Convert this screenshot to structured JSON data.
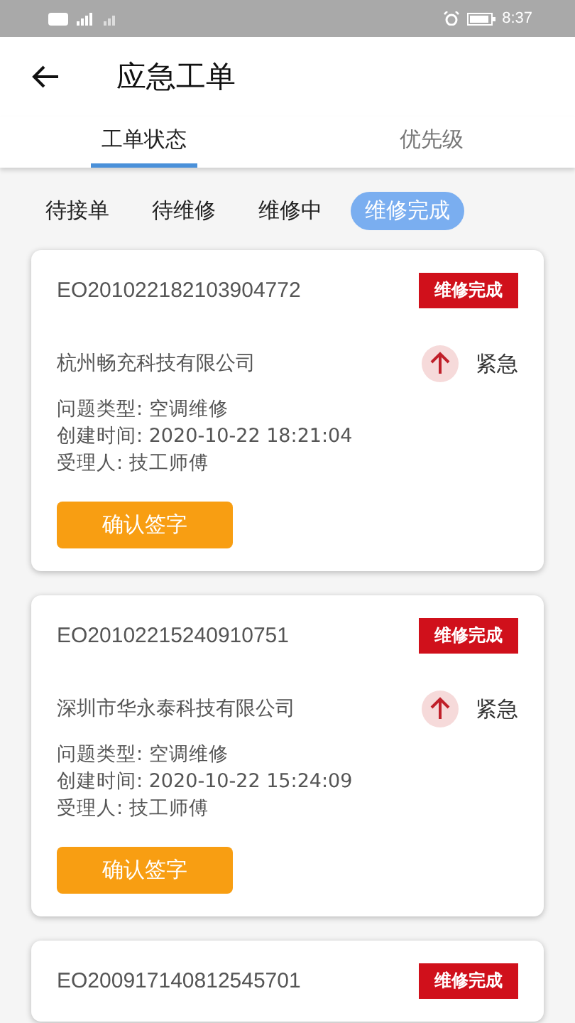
{
  "status_bar": {
    "time": "8:37"
  },
  "header": {
    "title": "应急工单"
  },
  "tabs": [
    {
      "label": "工单状态",
      "selected": true
    },
    {
      "label": "优先级",
      "selected": false
    }
  ],
  "filters": [
    {
      "label": "待接单",
      "selected": false
    },
    {
      "label": "待维修",
      "selected": false
    },
    {
      "label": "维修中",
      "selected": false
    },
    {
      "label": "维修完成",
      "selected": true
    }
  ],
  "orders": [
    {
      "id": "EO201022182103904772",
      "status": "维修完成",
      "company": "杭州畅充科技有限公司",
      "priority": "紧急",
      "details": [
        "问题类型: 空调维修",
        "创建时间: 2020-10-22 18:21:04",
        "受理人: 技工师傅"
      ],
      "action": "确认签字"
    },
    {
      "id": "EO20102215240910751",
      "status": "维修完成",
      "company": "深圳市华永泰科技有限公司",
      "priority": "紧急",
      "details": [
        "问题类型: 空调维修",
        "创建时间: 2020-10-22 15:24:09",
        "受理人: 技工师傅"
      ],
      "action": "确认签字"
    },
    {
      "id": "EO200917140812545701",
      "status": "维修完成"
    }
  ]
}
